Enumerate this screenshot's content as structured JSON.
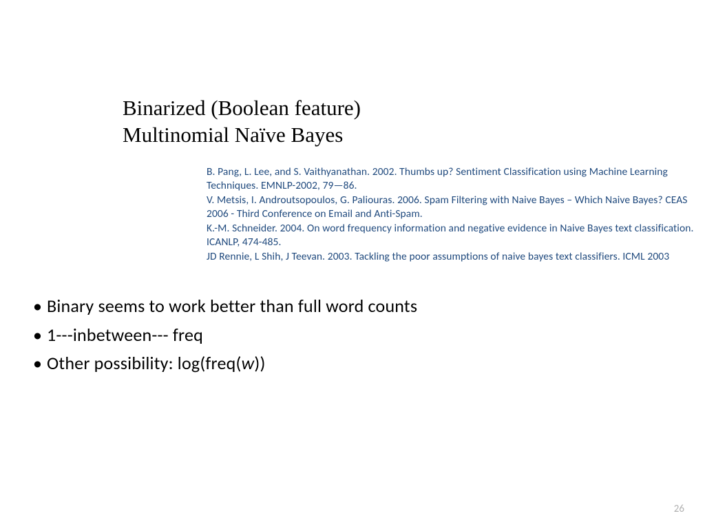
{
  "title": {
    "line1": "Binarized (Boolean feature)",
    "line2": "Multinomial Naïve Bayes"
  },
  "references": [
    "B. Pang, L. Lee, and S. Vaithyanathan.  2002.  Thumbs up? Sentiment Classification using Machine Learning Techniques. EMNLP-2002, 79—86.",
    "V. Metsis, I. Androutsopoulos, G. Paliouras. 2006. Spam Filtering with Naive Bayes – Which Naive Bayes? CEAS 2006 - Third Conference on Email and Anti-Spam.",
    "K.-M. Schneider. 2004. On word frequency information and negative evidence in Naive Bayes text classification. ICANLP, 474-485.",
    "JD Rennie, L Shih, J Teevan. 2003. Tackling the poor assumptions of naive bayes text classifiers. ICML 2003"
  ],
  "bullets": {
    "item1": "Binary seems to work better than full word counts",
    "item2": "1---inbetween--- freq",
    "item3_prefix": "Other possibility: log(freq(",
    "item3_var": "w",
    "item3_suffix": "))"
  },
  "pageNumber": "26"
}
